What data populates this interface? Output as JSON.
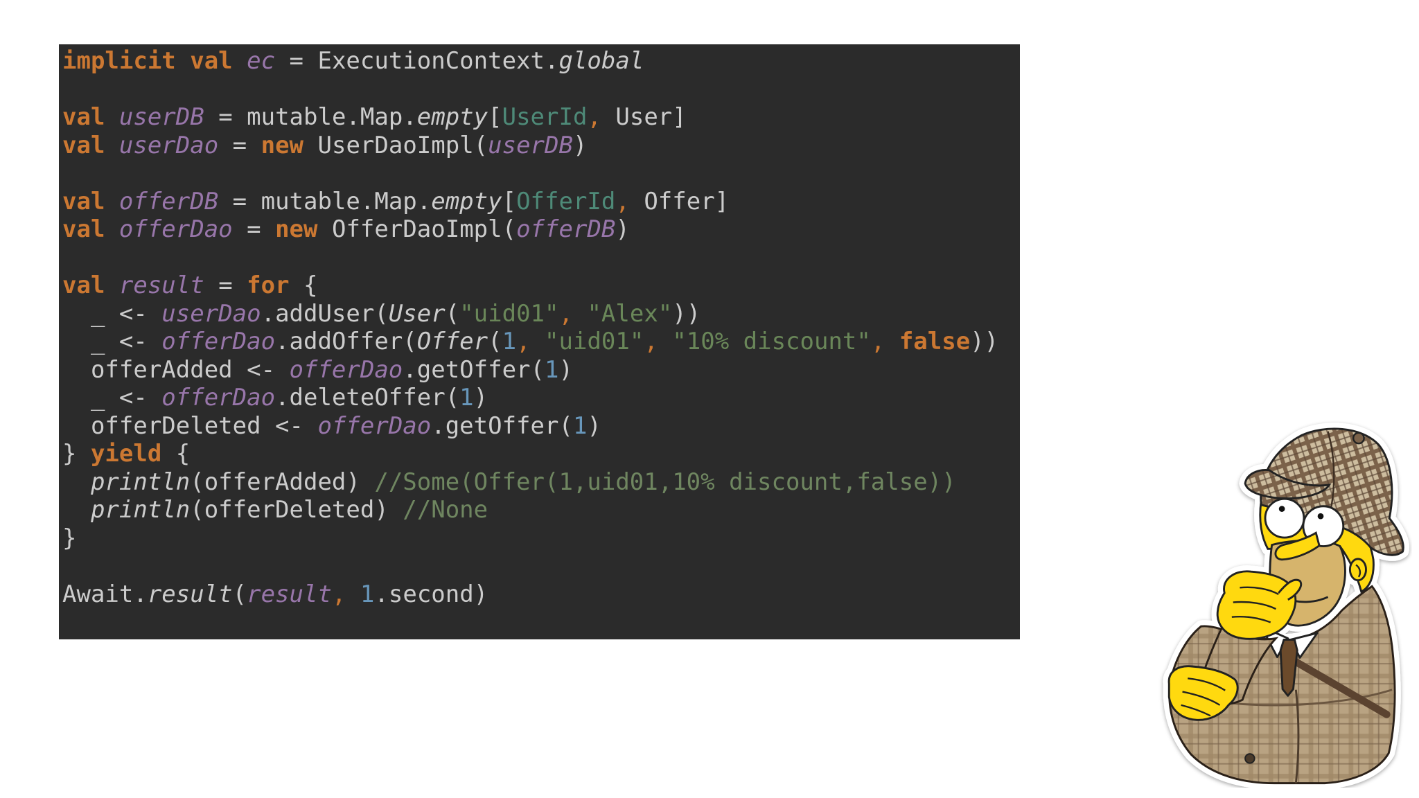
{
  "slide": {
    "code": {
      "lines": [
        [
          {
            "t": "implicit val ",
            "c": "#cc7832",
            "b": true
          },
          {
            "t": "ec",
            "c": "#9876aa",
            "i": true
          },
          {
            "t": " = ExecutionContext.",
            "c": "#cccccc"
          },
          {
            "t": "global",
            "c": "#cccccc",
            "i": true
          }
        ],
        [],
        [
          {
            "t": "val ",
            "c": "#cc7832",
            "b": true
          },
          {
            "t": "userDB",
            "c": "#9876aa",
            "i": true
          },
          {
            "t": " = mutable.Map.",
            "c": "#cccccc"
          },
          {
            "t": "empty",
            "c": "#cccccc",
            "i": true
          },
          {
            "t": "[",
            "c": "#cccccc"
          },
          {
            "t": "UserId",
            "c": "#4e8a78"
          },
          {
            "t": ",",
            "c": "#cc7832"
          },
          {
            "t": " User]",
            "c": "#cccccc"
          }
        ],
        [
          {
            "t": "val ",
            "c": "#cc7832",
            "b": true
          },
          {
            "t": "userDao",
            "c": "#9876aa",
            "i": true
          },
          {
            "t": " = ",
            "c": "#cccccc"
          },
          {
            "t": "new",
            "c": "#cc7832",
            "b": true
          },
          {
            "t": " UserDaoImpl(",
            "c": "#cccccc"
          },
          {
            "t": "userDB",
            "c": "#9876aa",
            "i": true
          },
          {
            "t": ")",
            "c": "#cccccc"
          }
        ],
        [],
        [
          {
            "t": "val ",
            "c": "#cc7832",
            "b": true
          },
          {
            "t": "offerDB",
            "c": "#9876aa",
            "i": true
          },
          {
            "t": " = mutable.Map.",
            "c": "#cccccc"
          },
          {
            "t": "empty",
            "c": "#cccccc",
            "i": true
          },
          {
            "t": "[",
            "c": "#cccccc"
          },
          {
            "t": "OfferId",
            "c": "#4e8a78"
          },
          {
            "t": ",",
            "c": "#cc7832"
          },
          {
            "t": " Offer]",
            "c": "#cccccc"
          }
        ],
        [
          {
            "t": "val ",
            "c": "#cc7832",
            "b": true
          },
          {
            "t": "offerDao",
            "c": "#9876aa",
            "i": true
          },
          {
            "t": " = ",
            "c": "#cccccc"
          },
          {
            "t": "new",
            "c": "#cc7832",
            "b": true
          },
          {
            "t": " OfferDaoImpl(",
            "c": "#cccccc"
          },
          {
            "t": "offerDB",
            "c": "#9876aa",
            "i": true
          },
          {
            "t": ")",
            "c": "#cccccc"
          }
        ],
        [],
        [
          {
            "t": "val ",
            "c": "#cc7832",
            "b": true
          },
          {
            "t": "result",
            "c": "#9876aa",
            "i": true
          },
          {
            "t": " = ",
            "c": "#cccccc"
          },
          {
            "t": "for",
            "c": "#cc7832",
            "b": true
          },
          {
            "t": " {",
            "c": "#cccccc"
          }
        ],
        [
          {
            "t": "  _ <- ",
            "c": "#cccccc"
          },
          {
            "t": "userDao",
            "c": "#9876aa",
            "i": true
          },
          {
            "t": ".addUser(",
            "c": "#cccccc"
          },
          {
            "t": "User",
            "c": "#cccccc",
            "i": true
          },
          {
            "t": "(",
            "c": "#cccccc"
          },
          {
            "t": "\"uid01\"",
            "c": "#6a8759"
          },
          {
            "t": ",",
            "c": "#cc7832"
          },
          {
            "t": " \"Alex\"",
            "c": "#6a8759"
          },
          {
            "t": "))",
            "c": "#cccccc"
          }
        ],
        [
          {
            "t": "  _ <- ",
            "c": "#cccccc"
          },
          {
            "t": "offerDao",
            "c": "#9876aa",
            "i": true
          },
          {
            "t": ".addOffer(",
            "c": "#cccccc"
          },
          {
            "t": "Offer",
            "c": "#cccccc",
            "i": true
          },
          {
            "t": "(",
            "c": "#cccccc"
          },
          {
            "t": "1",
            "c": "#6897bb"
          },
          {
            "t": ",",
            "c": "#cc7832"
          },
          {
            "t": " \"uid01\"",
            "c": "#6a8759"
          },
          {
            "t": ",",
            "c": "#cc7832"
          },
          {
            "t": " \"10% discount\"",
            "c": "#6a8759"
          },
          {
            "t": ",",
            "c": "#cc7832"
          },
          {
            "t": " false",
            "c": "#cc7832",
            "b": true
          },
          {
            "t": "))",
            "c": "#cccccc"
          }
        ],
        [
          {
            "t": "  offerAdded <- ",
            "c": "#cccccc"
          },
          {
            "t": "offerDao",
            "c": "#9876aa",
            "i": true
          },
          {
            "t": ".getOffer(",
            "c": "#cccccc"
          },
          {
            "t": "1",
            "c": "#6897bb"
          },
          {
            "t": ")",
            "c": "#cccccc"
          }
        ],
        [
          {
            "t": "  _ <- ",
            "c": "#cccccc"
          },
          {
            "t": "offerDao",
            "c": "#9876aa",
            "i": true
          },
          {
            "t": ".deleteOffer(",
            "c": "#cccccc"
          },
          {
            "t": "1",
            "c": "#6897bb"
          },
          {
            "t": ")",
            "c": "#cccccc"
          }
        ],
        [
          {
            "t": "  offerDeleted <- ",
            "c": "#cccccc"
          },
          {
            "t": "offerDao",
            "c": "#9876aa",
            "i": true
          },
          {
            "t": ".getOffer(",
            "c": "#cccccc"
          },
          {
            "t": "1",
            "c": "#6897bb"
          },
          {
            "t": ")",
            "c": "#cccccc"
          }
        ],
        [
          {
            "t": "} ",
            "c": "#cccccc"
          },
          {
            "t": "yield",
            "c": "#cc7832",
            "b": true
          },
          {
            "t": " {",
            "c": "#cccccc"
          }
        ],
        [
          {
            "t": "  println",
            "c": "#cccccc",
            "i": true
          },
          {
            "t": "(offerAdded) ",
            "c": "#cccccc"
          },
          {
            "t": "//Some(Offer(1,uid01,10% discount,false))",
            "c": "#6f8660"
          }
        ],
        [
          {
            "t": "  println",
            "c": "#cccccc",
            "i": true
          },
          {
            "t": "(offerDeleted) ",
            "c": "#cccccc"
          },
          {
            "t": "//None",
            "c": "#6f8660"
          }
        ],
        [
          {
            "t": "}",
            "c": "#cccccc"
          }
        ],
        [],
        [
          {
            "t": "Await.",
            "c": "#cccccc"
          },
          {
            "t": "result",
            "c": "#cccccc",
            "i": true
          },
          {
            "t": "(",
            "c": "#cccccc"
          },
          {
            "t": "result",
            "c": "#9876aa",
            "i": true
          },
          {
            "t": ",",
            "c": "#cc7832"
          },
          {
            "t": " 1",
            "c": "#6897bb"
          },
          {
            "t": ".second)",
            "c": "#cccccc"
          }
        ]
      ]
    },
    "illustration": {
      "icon": "detective-character-icon"
    }
  },
  "theme": {
    "page_background": "#ffffff",
    "code_background": "#2b2b2b"
  }
}
